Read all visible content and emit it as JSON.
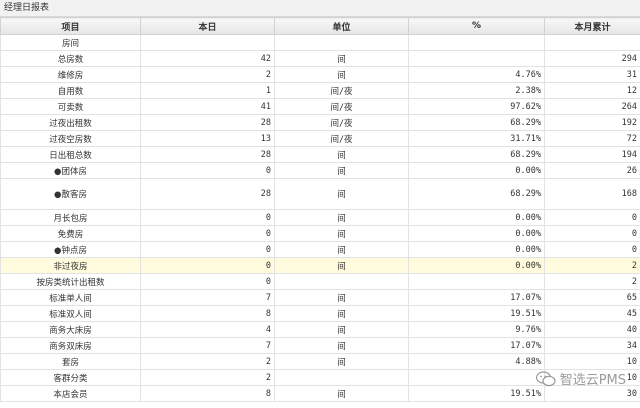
{
  "title": "经理日报表",
  "headers": [
    "项目",
    "本日",
    "单位",
    "%",
    "本月累计"
  ],
  "rows": [
    {
      "item": "房间",
      "day": "",
      "unit": "",
      "pct": "",
      "month": ""
    },
    {
      "item": "总房数",
      "day": "42",
      "unit": "间",
      "pct": "",
      "month": "294"
    },
    {
      "item": "维修房",
      "day": "2",
      "unit": "间",
      "pct": "4.76%",
      "month": "31"
    },
    {
      "item": "自用数",
      "day": "1",
      "unit": "间/夜",
      "pct": "2.38%",
      "month": "12"
    },
    {
      "item": "可卖数",
      "day": "41",
      "unit": "间/夜",
      "pct": "97.62%",
      "month": "264"
    },
    {
      "item": "过夜出租数",
      "day": "28",
      "unit": "间/夜",
      "pct": "68.29%",
      "month": "192"
    },
    {
      "item": "过夜空房数",
      "day": "13",
      "unit": "间/夜",
      "pct": "31.71%",
      "month": "72"
    },
    {
      "item": "日出租总数",
      "day": "28",
      "unit": "间",
      "pct": "68.29%",
      "month": "194"
    },
    {
      "item": "●团体房",
      "day": "0",
      "unit": "间",
      "pct": "0.00%",
      "month": "26"
    },
    {
      "item": "●散客房",
      "day": "28",
      "unit": "间",
      "pct": "68.29%",
      "month": "168",
      "tall": true
    },
    {
      "item": "月长包房",
      "day": "0",
      "unit": "间",
      "pct": "0.00%",
      "month": "0"
    },
    {
      "item": "免费房",
      "day": "0",
      "unit": "间",
      "pct": "0.00%",
      "month": "0"
    },
    {
      "item": "●钟点房",
      "day": "0",
      "unit": "间",
      "pct": "0.00%",
      "month": "0"
    },
    {
      "item": "非过夜房",
      "day": "0",
      "unit": "间",
      "pct": "0.00%",
      "month": "2",
      "highlight": true
    },
    {
      "item": "按房类统计出租数",
      "day": "0",
      "unit": "",
      "pct": "",
      "month": "2"
    },
    {
      "item": "标准单人间",
      "day": "7",
      "unit": "间",
      "pct": "17.07%",
      "month": "65"
    },
    {
      "item": "标准双人间",
      "day": "8",
      "unit": "间",
      "pct": "19.51%",
      "month": "45"
    },
    {
      "item": "商务大床房",
      "day": "4",
      "unit": "间",
      "pct": "9.76%",
      "month": "40"
    },
    {
      "item": "商务双床房",
      "day": "7",
      "unit": "间",
      "pct": "17.07%",
      "month": "34"
    },
    {
      "item": "套房",
      "day": "2",
      "unit": "间",
      "pct": "4.88%",
      "month": "10"
    },
    {
      "item": "客群分类",
      "day": "2",
      "unit": "",
      "pct": "",
      "month": "10"
    },
    {
      "item": "本店会员",
      "day": "8",
      "unit": "间",
      "pct": "19.51%",
      "month": "30"
    }
  ],
  "watermark": "智选云PMS"
}
